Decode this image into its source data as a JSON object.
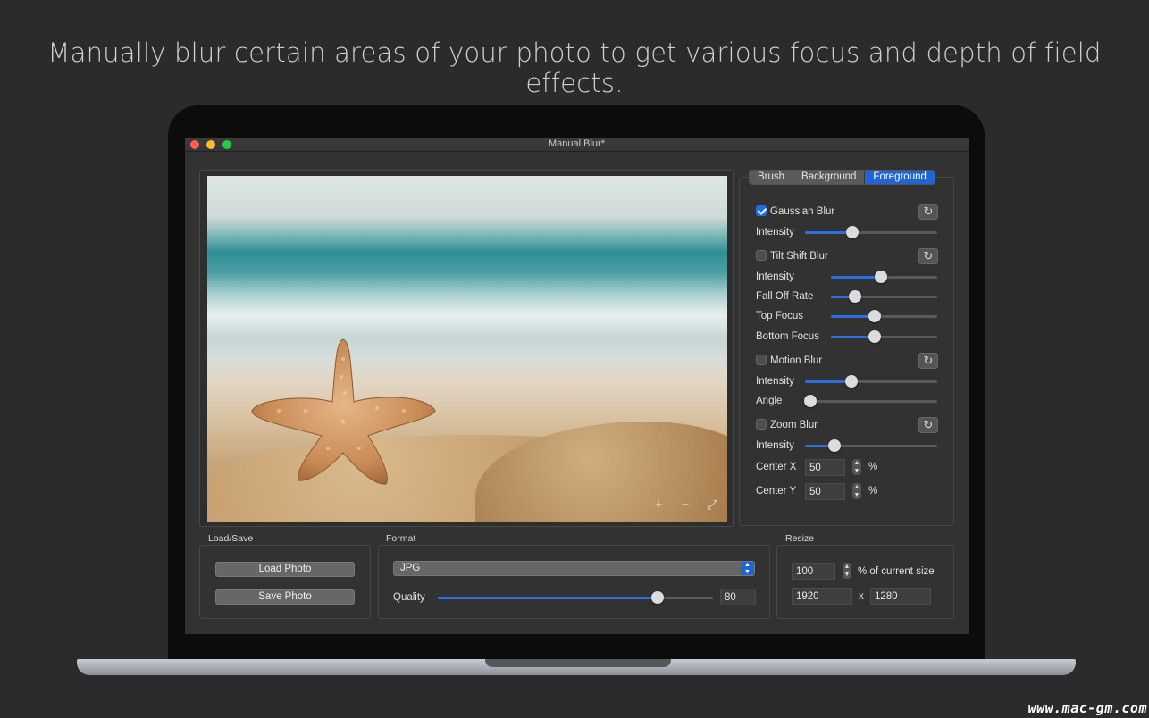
{
  "headline": "Manually blur certain areas of your photo to get various focus and depth of field effects.",
  "window": {
    "title": "Manual Blur*"
  },
  "tabs": [
    {
      "label": "Brush",
      "active": false
    },
    {
      "label": "Background",
      "active": false
    },
    {
      "label": "Foreground",
      "active": true
    }
  ],
  "gaussian": {
    "label": "Gaussian Blur",
    "checked": true,
    "intensity_label": "Intensity",
    "intensity": 0.36
  },
  "tilt_shift": {
    "label": "Tilt Shift Blur",
    "checked": false,
    "intensity_label": "Intensity",
    "intensity": 0.47,
    "falloff_label": "Fall Off Rate",
    "falloff": 0.23,
    "top_label": "Top Focus",
    "top": 0.41,
    "bottom_label": "Bottom Focus",
    "bottom": 0.41
  },
  "motion": {
    "label": "Motion Blur",
    "checked": false,
    "intensity_label": "Intensity",
    "intensity": 0.35,
    "angle_label": "Angle",
    "angle": 0.04
  },
  "zoom": {
    "label": "Zoom Blur",
    "checked": false,
    "intensity_label": "Intensity",
    "intensity": 0.22,
    "center_x_label": "Center X",
    "center_x": "50",
    "center_y_label": "Center Y",
    "center_y": "50",
    "unit": "%"
  },
  "load_save": {
    "label": "Load/Save",
    "load_button": "Load Photo",
    "save_button": "Save Photo"
  },
  "format": {
    "label": "Format",
    "selected": "JPG",
    "quality_label": "Quality",
    "quality_value": "80",
    "quality": 0.8
  },
  "resize": {
    "label": "Resize",
    "percent": "100",
    "percent_label": "% of current size",
    "width": "1920",
    "times": "x",
    "height": "1280"
  },
  "watermark": "www.mac-gm.com",
  "colors": {
    "accent": "#1f65d6",
    "background": "#2b2b2b",
    "window": "#323232"
  },
  "icons": {
    "reset": "reset-icon",
    "zoom_in": "zoom-in-icon",
    "zoom_out": "zoom-out-icon",
    "fit": "fit-screen-icon"
  }
}
